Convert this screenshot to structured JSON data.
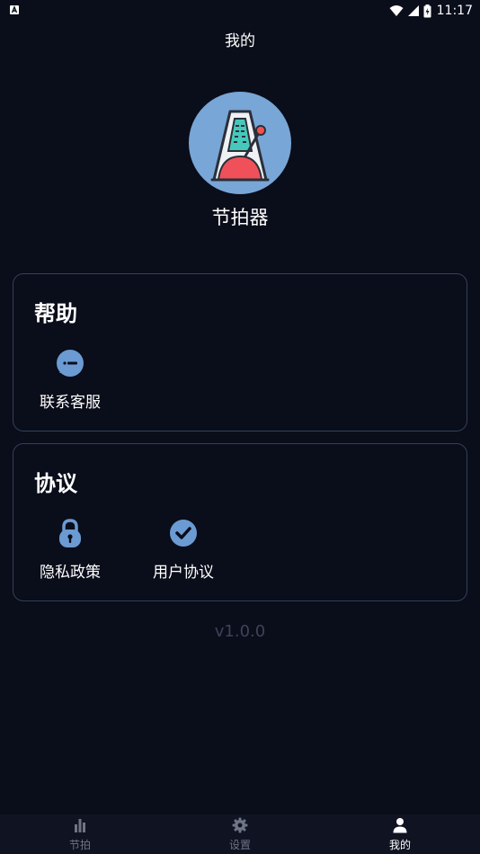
{
  "status_bar": {
    "time": "11:17",
    "icons": [
      "app-notification-icon",
      "wifi-icon",
      "signal-icon",
      "battery-icon"
    ]
  },
  "header": {
    "title": "我的"
  },
  "profile": {
    "app_name": "节拍器",
    "avatar_icon": "metronome-icon",
    "avatar_bg": "#78a6d6"
  },
  "help_section": {
    "title": "帮助",
    "items": [
      {
        "label": "联系客服",
        "icon": "chat-bubble-icon"
      }
    ]
  },
  "agreement_section": {
    "title": "协议",
    "items": [
      {
        "label": "隐私政策",
        "icon": "lock-icon"
      },
      {
        "label": "用户协议",
        "icon": "check-circle-icon"
      }
    ]
  },
  "version": "v1.0.0",
  "bottom_nav": {
    "items": [
      {
        "label": "节拍",
        "icon": "bar-chart-icon",
        "active": false
      },
      {
        "label": "设置",
        "icon": "gear-icon",
        "active": false
      },
      {
        "label": "我的",
        "icon": "person-icon",
        "active": true
      }
    ]
  },
  "colors": {
    "background": "#0a0d1a",
    "card_border": "#33405c",
    "icon_blue": "#6b9bd2",
    "version_text": "#3c4458",
    "nav_inactive": "#6f7585"
  }
}
